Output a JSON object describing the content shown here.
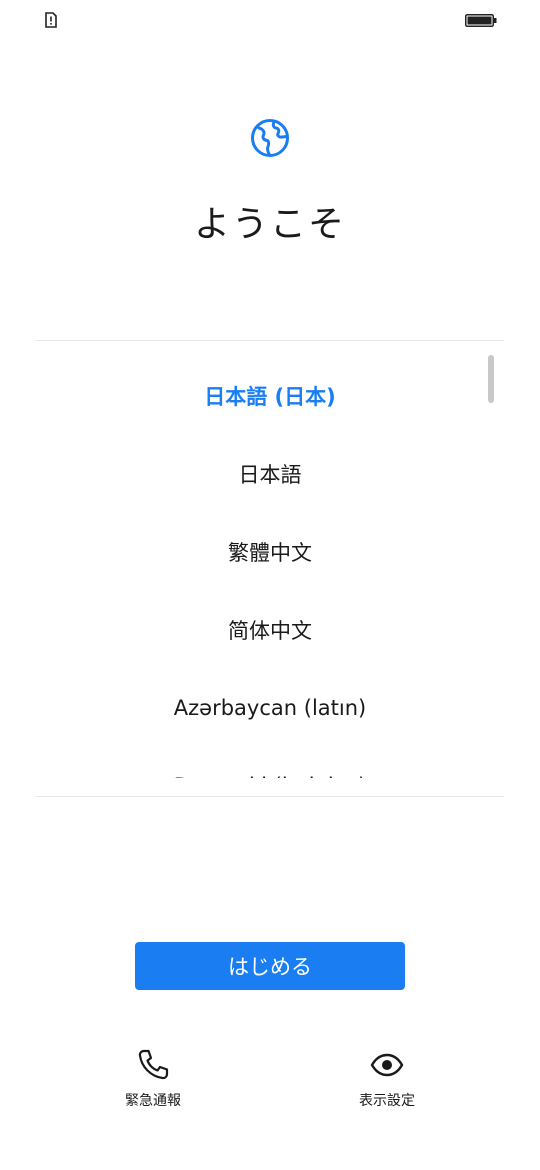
{
  "status_bar": {
    "icons": [
      "sim-alert-icon",
      "battery-icon"
    ]
  },
  "header": {
    "icon": "globe-icon",
    "title": "ようこそ"
  },
  "language_picker": {
    "selected": "日本語 (日本)",
    "items": [
      "日本語 (日本)",
      "日本語",
      "繁體中文",
      "简体中文",
      "Azərbaycan (latın)",
      "Bosanski (latinica)"
    ]
  },
  "start_button": {
    "label": "はじめる"
  },
  "bottom_actions": {
    "emergency": {
      "label": "緊急通報",
      "icon": "phone-icon"
    },
    "display": {
      "label": "表示設定",
      "icon": "eye-icon"
    }
  },
  "colors": {
    "accent": "#1a7ef2",
    "text": "#1a1a1a",
    "divider": "#e6e6e6"
  }
}
